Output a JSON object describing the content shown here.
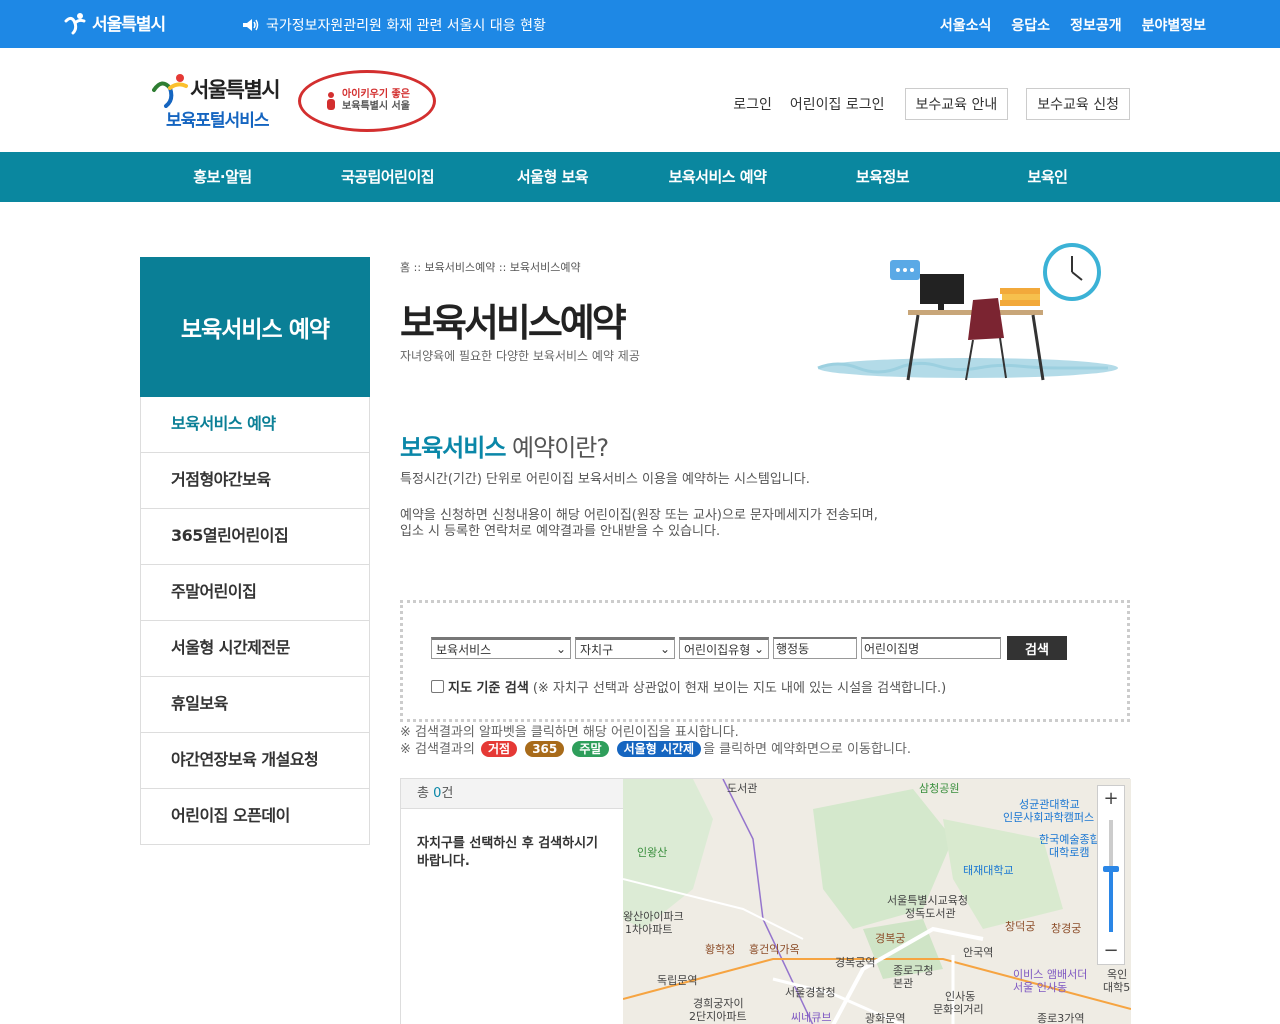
{
  "topbar": {
    "logo_text": "서울특별시",
    "notice": "국가정보자원관리원 화재 관련 서울시 대응 현황",
    "util": [
      "서울소식",
      "응답소",
      "정보공개",
      "분야별정보"
    ]
  },
  "header": {
    "brand_city": "서울특별시",
    "brand_service": "보육포털서비스",
    "badge_line1": "아이키우기 좋은",
    "badge_line2": "보육특별시 서울",
    "links": [
      "로그인",
      "어린이집 로그인"
    ],
    "boxes": [
      "보수교육 안내",
      "보수교육 신청"
    ]
  },
  "gnb": [
    "홍보·알림",
    "국공립어린이집",
    "서울형 보육",
    "보육서비스 예약",
    "보육정보",
    "보육인"
  ],
  "lnb": {
    "title": "보육서비스 예약",
    "items": [
      "보육서비스 예약",
      "거점형야간보육",
      "365열린어린이집",
      "주말어린이집",
      "서울형 시간제전문",
      "휴일보육",
      "야간연장보육 개설요청",
      "어린이집 오픈데이"
    ]
  },
  "content": {
    "breadcrumb": "홈 :: 보육서비스예약 :: 보육서비스예약",
    "title": "보육서비스예약",
    "subtitle": "자녀양육에 필요한 다양한 보육서비스 예약 제공",
    "section_title_highlight": "보육서비스",
    "section_title_rest": " 예약이란?",
    "desc1": "특정시간(기간) 단위로 어린이집 보육서비스 이용을 예약하는 시스템입니다.",
    "desc2_line1": "예약을 신청하면 신청내용이 해당 어린이집(원장 또는 교사)으로 문자메세지가 전송되며,",
    "desc2_line2": "입소 시 등록한 연락처로 예약결과를 안내받을 수 있습니다."
  },
  "search": {
    "service_select": "보육서비스",
    "district_select": "자치구",
    "type_select": "어린이집유형",
    "dong_input": "행정동",
    "name_input": "어린이집명",
    "button": "검색",
    "map_check_label": "지도 기준 검색",
    "map_check_note": "(※ 자치구 선택과 상관없이 현재 보이는 지도 내에 있는 시설을 검색합니다.)"
  },
  "notes": {
    "line1": "※ 검색결과의 알파벳을 클릭하면 해당 어린이집을 표시합니다.",
    "line2_prefix": "※ 검색결과의",
    "line2_suffix": "을 클릭하면 예약화면으로 이동합니다.",
    "tags": [
      {
        "label": "거점",
        "color": "#e53935"
      },
      {
        "label": "365",
        "color": "#a86b1a"
      },
      {
        "label": "주말",
        "color": "#2e9e5b"
      },
      {
        "label": "서울형 시간제",
        "color": "#1565c0"
      }
    ]
  },
  "result": {
    "count_prefix": "총 ",
    "count": "0",
    "count_suffix": "건",
    "message": "자치구를 선택하신 후 검색하시기 바랍니다."
  },
  "map": {
    "labels": [
      "도서관",
      "삼청공원",
      "성균관대학교",
      "인문사회과학캠퍼스",
      "한국예술종합",
      "대학로캠",
      "인왕산",
      "태재대학교",
      "서울특별시교육청",
      "정독도서관",
      "왕산아이파크",
      "1차아파트",
      "창덕궁",
      "창경궁",
      "경복궁",
      "황학정",
      "홍건익가옥",
      "경복궁역",
      "종로구청",
      "본관",
      "안국역",
      "이비스 앰배서더",
      "서울 인사동",
      "독립문역",
      "서울경찰청",
      "인사동",
      "문화의거리",
      "경희궁자이",
      "2단지아파트",
      "씨네큐브",
      "광화문역",
      "종로3가역",
      "옥인",
      "대학5"
    ],
    "zoom_plus": "+",
    "zoom_minus": "−"
  }
}
